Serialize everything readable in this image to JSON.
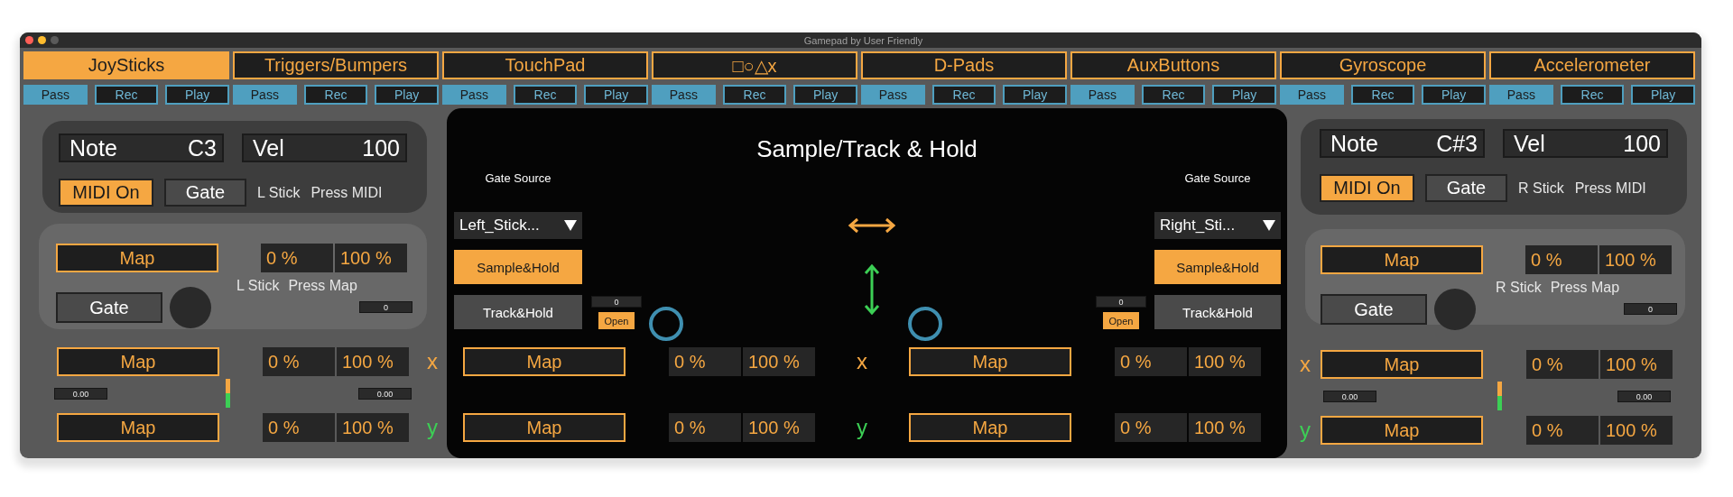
{
  "window": {
    "title": "Gamepad by User Friendly"
  },
  "tabs": [
    {
      "label": "JoySticks",
      "selected": true,
      "modes": [
        {
          "label": "Pass",
          "selected": true
        },
        {
          "label": "Rec",
          "selected": false
        },
        {
          "label": "Play",
          "selected": false
        }
      ]
    },
    {
      "label": "Triggers/Bumpers",
      "selected": false,
      "modes": [
        {
          "label": "Pass",
          "selected": true
        },
        {
          "label": "Rec",
          "selected": false
        },
        {
          "label": "Play",
          "selected": false
        }
      ]
    },
    {
      "label": "TouchPad",
      "selected": false,
      "modes": [
        {
          "label": "Pass",
          "selected": true
        },
        {
          "label": "Rec",
          "selected": false
        },
        {
          "label": "Play",
          "selected": false
        }
      ]
    },
    {
      "label": "□○△x",
      "selected": false,
      "modes": [
        {
          "label": "Pass",
          "selected": true
        },
        {
          "label": "Rec",
          "selected": false
        },
        {
          "label": "Play",
          "selected": false
        }
      ]
    },
    {
      "label": "D-Pads",
      "selected": false,
      "modes": [
        {
          "label": "Pass",
          "selected": true
        },
        {
          "label": "Rec",
          "selected": false
        },
        {
          "label": "Play",
          "selected": false
        }
      ]
    },
    {
      "label": "AuxButtons",
      "selected": false,
      "modes": [
        {
          "label": "Pass",
          "selected": true
        },
        {
          "label": "Rec",
          "selected": false
        },
        {
          "label": "Play",
          "selected": false
        }
      ]
    },
    {
      "label": "Gyroscope",
      "selected": false,
      "modes": [
        {
          "label": "Pass",
          "selected": true
        },
        {
          "label": "Rec",
          "selected": false
        },
        {
          "label": "Play",
          "selected": false
        }
      ]
    },
    {
      "label": "Accelerometer",
      "selected": false,
      "modes": [
        {
          "label": "Pass",
          "selected": true
        },
        {
          "label": "Rec",
          "selected": false
        },
        {
          "label": "Play",
          "selected": false
        }
      ]
    }
  ],
  "panels": [
    {
      "kind": "left",
      "note": {
        "label": "Note",
        "value": "C3"
      },
      "velocity": {
        "label": "Vel",
        "value": "100"
      },
      "midi_button": {
        "label": "MIDI On",
        "on": true
      },
      "gate_button": {
        "label": "Gate",
        "on": false
      },
      "stick_label": "L Stick",
      "press_midi_label": "Press MIDI",
      "press": {
        "map": "Map",
        "min": "0 %",
        "max": "100 %",
        "gate": {
          "label": "Gate",
          "on": false
        },
        "stick_label": "L Stick",
        "press_map_label": "Press Map",
        "value": "0"
      },
      "axes": [
        {
          "label": "x",
          "color": "#f5a742",
          "map": "Map",
          "min": "0 %",
          "max": "100 %"
        },
        {
          "label": "y",
          "color": "#3ccf55",
          "map": "Map",
          "min": "0 %",
          "max": "100 %"
        }
      ],
      "readouts": [
        "0.00",
        "0.00"
      ]
    },
    {
      "kind": "right",
      "note": {
        "label": "Note",
        "value": "C#3"
      },
      "velocity": {
        "label": "Vel",
        "value": "100"
      },
      "midi_button": {
        "label": "MIDI On",
        "on": true
      },
      "gate_button": {
        "label": "Gate",
        "on": false
      },
      "stick_label": "R Stick",
      "press_midi_label": "Press MIDI",
      "press": {
        "map": "Map",
        "min": "0 %",
        "max": "100 %",
        "gate": {
          "label": "Gate",
          "on": false
        },
        "stick_label": "R Stick",
        "press_map_label": "Press Map",
        "value": "0"
      },
      "axes": [
        {
          "label": "x",
          "color": "#f5a742",
          "map": "Map",
          "min": "0 %",
          "max": "100 %"
        },
        {
          "label": "y",
          "color": "#3ccf55",
          "map": "Map",
          "min": "0 %",
          "max": "100 %"
        }
      ],
      "readouts": [
        "0.00",
        "0.00"
      ]
    }
  ],
  "center": {
    "title": "Sample/Track & Hold",
    "sources": [
      {
        "kind": "left",
        "label": "Gate Source",
        "dropdown": "Left_Stick...",
        "sample_hold": {
          "label": "Sample&Hold",
          "selected": true
        },
        "track_hold": {
          "label": "Track&Hold",
          "selected": false
        },
        "value": "0",
        "open": "Open"
      },
      {
        "kind": "right",
        "label": "Gate Source",
        "dropdown": "Right_Sti...",
        "sample_hold": {
          "label": "Sample&Hold",
          "selected": true
        },
        "track_hold": {
          "label": "Track&Hold",
          "selected": false
        },
        "value": "0",
        "open": "Open"
      }
    ],
    "rows": [
      {
        "label": "x",
        "color": "#f5a742",
        "pairs": [
          {
            "map": "Map",
            "min": "0 %",
            "max": "100 %"
          },
          {
            "map": "Map",
            "min": "0 %",
            "max": "100 %"
          }
        ]
      },
      {
        "label": "y",
        "color": "#3ccf55",
        "pairs": [
          {
            "map": "Map",
            "min": "0 %",
            "max": "100 %"
          },
          {
            "map": "Map",
            "min": "0 %",
            "max": "100 %"
          }
        ]
      }
    ]
  }
}
